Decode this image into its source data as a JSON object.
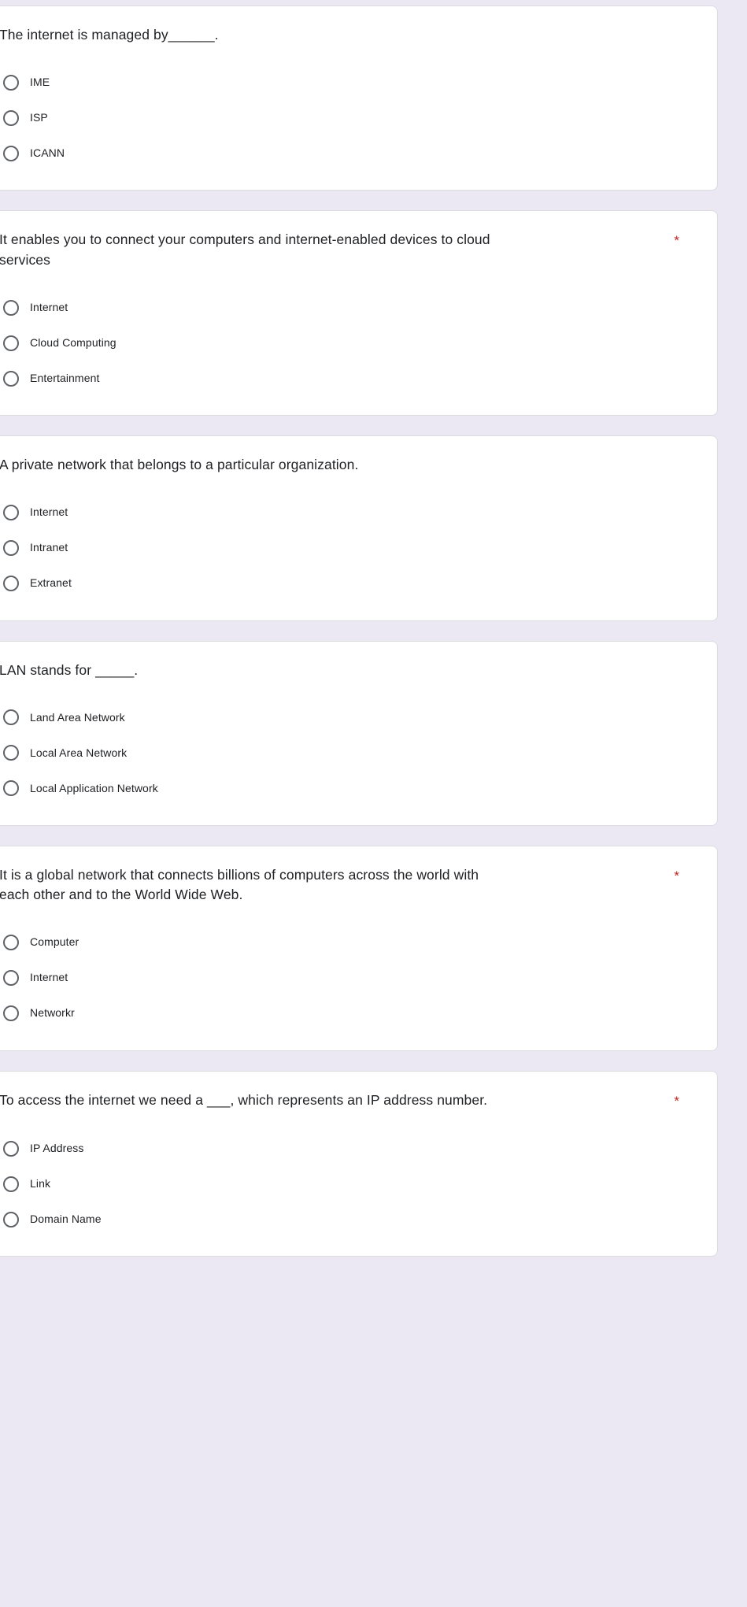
{
  "page": {
    "background_color": "#ebe8f4",
    "card_color": "#ffffff",
    "required_marker": "*",
    "required_marker_color": "#c5221f",
    "radio_icon": "radio-unselected-icon"
  },
  "questions": [
    {
      "title": "The internet is managed by______.",
      "required": "*",
      "required_inline": true,
      "options": [
        "IME",
        "ISP",
        "ICANN"
      ]
    },
    {
      "title": "It enables you to connect your computers and internet-enabled devices to cloud services",
      "required": "*",
      "required_inline": false,
      "options": [
        "Internet",
        "Cloud Computing",
        "Entertainment"
      ]
    },
    {
      "title": "A private network that belongs to a particular organization.",
      "required": "*",
      "required_inline": true,
      "options": [
        "Internet",
        "Intranet",
        "Extranet"
      ]
    },
    {
      "title": "LAN stands for _____.",
      "required": "*",
      "required_inline": true,
      "options": [
        "Land Area Network",
        "Local Area Network",
        "Local Application Network"
      ]
    },
    {
      "title": "It is a global network that connects billions of computers across the world with each other and to the World Wide Web.",
      "required": "*",
      "required_inline": false,
      "options": [
        "Computer",
        "Internet",
        "Networkr"
      ]
    },
    {
      "title": "To access the internet we need a ___, which represents an IP address number.",
      "required": "*",
      "required_inline": false,
      "options": [
        "IP Address",
        "Link",
        "Domain Name"
      ]
    }
  ]
}
